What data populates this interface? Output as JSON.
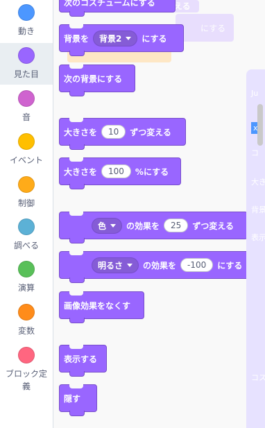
{
  "categories": [
    {
      "label": "動き",
      "color": "#4c97ff"
    },
    {
      "label": "見た目",
      "color": "#9966ff"
    },
    {
      "label": "音",
      "color": "#cf63cf"
    },
    {
      "label": "イベント",
      "color": "#ffbf00"
    },
    {
      "label": "制御",
      "color": "#ffab19"
    },
    {
      "label": "調べる",
      "color": "#5cb1d6"
    },
    {
      "label": "演算",
      "color": "#59c059"
    },
    {
      "label": "変数",
      "color": "#ff8c1a"
    },
    {
      "label": "ブロック定義",
      "color": "#ff6680"
    }
  ],
  "blocks": {
    "costume_partial": "次のコスチュームにする",
    "backdrop_prefix": "背景を",
    "backdrop_value": "背景2",
    "backdrop_suffix": "にする",
    "next_backdrop": "次の背景にする",
    "size_change_prefix": "大きさを",
    "size_change_value": "10",
    "size_change_suffix": "ずつ変える",
    "size_set_prefix": "大きさを",
    "size_set_value": "100",
    "size_set_suffix": "%にする",
    "effect_change_dd": "色",
    "effect_change_mid": "の効果を",
    "effect_change_value": "25",
    "effect_change_suffix": "ずつ変える",
    "effect_set_dd": "明るさ",
    "effect_set_mid": "の効果を",
    "effect_set_value": "-100",
    "effect_set_suffix": "にする",
    "clear_effects": "画像効果をなくす",
    "show": "表示する",
    "hide": "隠す"
  },
  "ghost": {
    "text1": "え変える",
    "text2": "にする"
  },
  "stage_edge": {
    "t1": "Ju",
    "t2": "x",
    "t3": "コ",
    "t4": "大き",
    "t5": "背景",
    "t6": "表示",
    "t7": "コス"
  }
}
